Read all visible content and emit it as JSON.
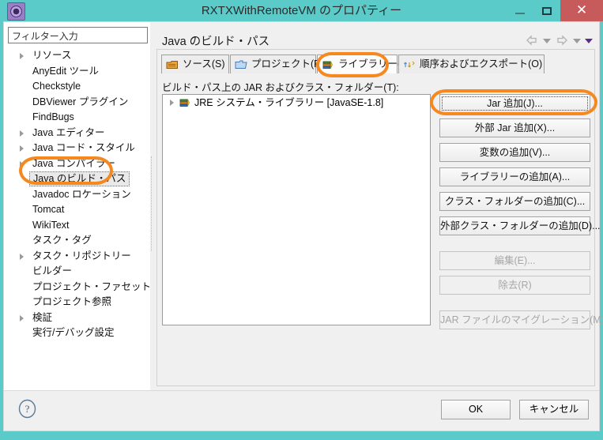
{
  "window": {
    "title": "RXTXWithRemoteVM のプロパティー",
    "app_icon": "gear-icon",
    "minimize_label": "_",
    "maximize_label": "□",
    "close_label": "✕",
    "accent_color": "#5bcbc9",
    "annotation_color": "#f5881f"
  },
  "sidebar": {
    "filter": {
      "value": "フィルター入力",
      "placeholder": "フィルター入力"
    },
    "items": [
      {
        "label": "リソース",
        "expandable": true,
        "selected": false
      },
      {
        "label": "AnyEdit ツール",
        "expandable": false,
        "selected": false
      },
      {
        "label": "Checkstyle",
        "expandable": false,
        "selected": false
      },
      {
        "label": "DBViewer プラグイン",
        "expandable": false,
        "selected": false
      },
      {
        "label": "FindBugs",
        "expandable": false,
        "selected": false
      },
      {
        "label": "Java エディター",
        "expandable": true,
        "selected": false
      },
      {
        "label": "Java コード・スタイル",
        "expandable": true,
        "selected": false
      },
      {
        "label": "Java コンパイラー",
        "expandable": true,
        "selected": false
      },
      {
        "label": "Java のビルド・パス",
        "expandable": false,
        "selected": true
      },
      {
        "label": "Javadoc ロケーション",
        "expandable": false,
        "selected": false
      },
      {
        "label": "Tomcat",
        "expandable": false,
        "selected": false
      },
      {
        "label": "WikiText",
        "expandable": false,
        "selected": false
      },
      {
        "label": "タスク・タグ",
        "expandable": false,
        "selected": false
      },
      {
        "label": "タスク・リポジトリー",
        "expandable": true,
        "selected": false
      },
      {
        "label": "ビルダー",
        "expandable": false,
        "selected": false
      },
      {
        "label": "プロジェクト・ファセット",
        "expandable": false,
        "selected": false
      },
      {
        "label": "プロジェクト参照",
        "expandable": false,
        "selected": false
      },
      {
        "label": "検証",
        "expandable": true,
        "selected": false
      },
      {
        "label": "実行/デバッグ設定",
        "expandable": false,
        "selected": false
      }
    ]
  },
  "main": {
    "page_title": "Java のビルド・パス",
    "nav": {
      "back_icon": "back-arrow-icon",
      "back_menu_icon": "chevron-down-icon",
      "forward_icon": "forward-arrow-icon",
      "forward_menu_icon": "chevron-down-icon",
      "menu_icon": "chevron-down-icon"
    },
    "tabs": [
      {
        "label": "ソース(S)",
        "icon": "package-folder-icon",
        "active": false,
        "mnemonic": "S"
      },
      {
        "label": "プロジェクト(P)",
        "icon": "blue-folder-icon",
        "active": false,
        "mnemonic": "P"
      },
      {
        "label": "ライブラリー(L)",
        "icon": "books-icon",
        "active": true,
        "mnemonic": "L"
      },
      {
        "label": "順序およびエクスポート(O)",
        "icon": "order-export-icon",
        "active": false,
        "mnemonic": "O"
      }
    ],
    "list_label": "ビルド・パス上の JAR およびクラス・フォルダー(T):",
    "list_rows": [
      {
        "label": "JRE システム・ライブラリー [JavaSE-1.8]",
        "icon": "books-icon",
        "expandable": true
      }
    ],
    "buttons": [
      {
        "label": "Jar 追加(J)...",
        "disabled": false,
        "focused": true
      },
      {
        "label": "外部 Jar 追加(X)...",
        "disabled": false,
        "focused": false
      },
      {
        "label": "変数の追加(V)...",
        "disabled": false,
        "focused": false
      },
      {
        "label": "ライブラリーの追加(A)...",
        "disabled": false,
        "focused": false
      },
      {
        "label": "クラス・フォルダーの追加(C)...",
        "disabled": false,
        "focused": false
      },
      {
        "label": "外部クラス・フォルダーの追加(D)...",
        "disabled": false,
        "focused": false
      },
      {
        "label": "編集(E)...",
        "disabled": true,
        "focused": false
      },
      {
        "label": "除去(R)",
        "disabled": true,
        "focused": false
      },
      {
        "label": "JAR ファイルのマイグレーション(M)...",
        "disabled": true,
        "focused": false
      }
    ]
  },
  "footer": {
    "help_icon": "help-question-icon",
    "ok_label": "OK",
    "cancel_label": "キャンセル"
  }
}
